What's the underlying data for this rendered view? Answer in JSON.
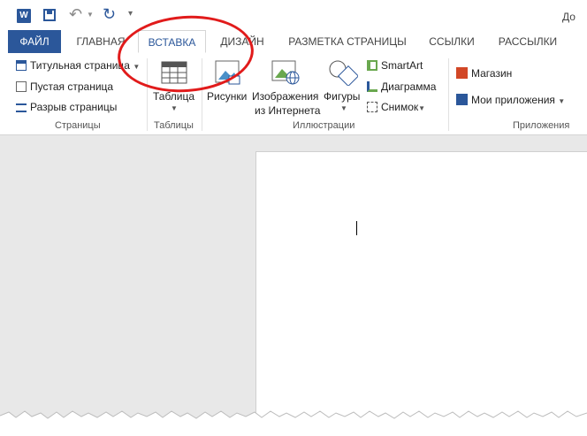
{
  "quick_access": {
    "app_icon": "word-icon",
    "title_fragment": "До"
  },
  "tabs": [
    {
      "label": "ФАЙЛ"
    },
    {
      "label": "ГЛАВНАЯ"
    },
    {
      "label": "ВСТАВКА",
      "active": true
    },
    {
      "label": "ДИЗАЙН"
    },
    {
      "label": "РАЗМЕТКА СТРАНИЦЫ"
    },
    {
      "label": "ССЫЛКИ"
    },
    {
      "label": "РАССЫЛКИ"
    }
  ],
  "ribbon": {
    "pages": {
      "items": [
        "Титульная страница",
        "Пустая страница",
        "Разрыв страницы"
      ],
      "group_label": "Страницы"
    },
    "tables": {
      "button": "Таблица",
      "group_label": "Таблицы"
    },
    "illustrations": {
      "pictures": "Рисунки",
      "online_line1": "Изображения",
      "online_line2": "из Интернета",
      "shapes": "Фигуры",
      "smartart": "SmartArt",
      "chart": "Диаграмма",
      "screenshot": "Снимок",
      "group_label": "Иллюстрации"
    },
    "apps": {
      "store": "Магазин",
      "my_apps": "Мои приложения",
      "group_label": "Приложения"
    }
  },
  "colors": {
    "accent": "#2b579a",
    "highlight_circle": "#e11b1b"
  }
}
